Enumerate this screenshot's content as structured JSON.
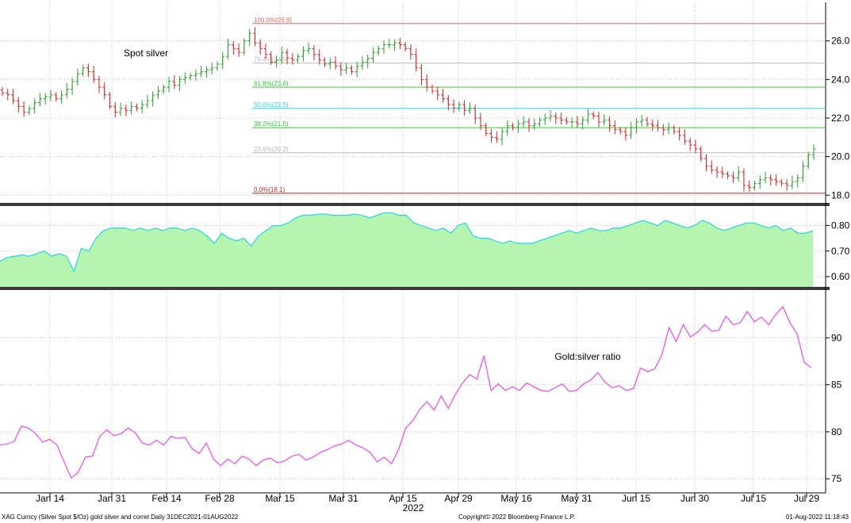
{
  "colors": {
    "bg": "#ffffff",
    "grid": "#c8c8c8",
    "candle_up": "#2ca02c",
    "candle_down": "#d62728",
    "correl_fill": "#b6f5b0",
    "correl_line": "#35d6e8",
    "ratio_line": "#ee55ee",
    "fib_0": "#cc2222",
    "fib_23_6": "#bbbbbb",
    "fib_38_2": "#33cc33",
    "fib_50": "#22dddd",
    "fib_61_8": "#33cc33",
    "fib_76_4": "#bbbbbb",
    "fib_100": "#ee6666"
  },
  "footer": {
    "left": "XAG Curncy (Silver Spot  $/Oz) gold silver and correl  Daily 31DEC2021-01AUG2022",
    "center": "Copyright© 2022 Bloomberg Finance L.P.",
    "right": "01-Aug-2022 11:18:43"
  },
  "chart_data": [
    {
      "type": "candlestick",
      "title": "Spot silver",
      "ylim": [
        17.6,
        28.0
      ],
      "yticks": [
        "18.0",
        "20.0",
        "22.0",
        "24.0",
        "26.0"
      ],
      "fib_levels": [
        {
          "label": "100.0%(26.9)",
          "value": 26.9,
          "color_key": "fib_100"
        },
        {
          "label": "76.4%(24.9)",
          "value": 24.85,
          "color_key": "fib_76_4"
        },
        {
          "label": "61.8%(23.6)",
          "value": 23.6,
          "color_key": "fib_61_8"
        },
        {
          "label": "50.0%(22.5)",
          "value": 22.5,
          "color_key": "fib_50"
        },
        {
          "label": "38.2%(21.5)",
          "value": 21.5,
          "color_key": "fib_38_2"
        },
        {
          "label": "23.6%(20.2)",
          "value": 20.2,
          "color_key": "fib_23_6"
        },
        {
          "label": "0.0%(18.1)",
          "value": 18.1,
          "color_key": "fib_0"
        }
      ],
      "close_path": [
        23.3,
        23.2,
        22.9,
        22.6,
        22.3,
        22.5,
        22.8,
        23.0,
        23.1,
        23.2,
        23.0,
        23.2,
        23.5,
        23.9,
        24.3,
        24.6,
        24.4,
        24.0,
        23.6,
        23.2,
        22.6,
        22.3,
        22.5,
        22.4,
        22.6,
        22.5,
        22.7,
        22.9,
        23.2,
        23.4,
        23.6,
        23.9,
        23.7,
        24.0,
        24.1,
        24.2,
        24.3,
        24.4,
        24.5,
        24.6,
        24.8,
        25.2,
        25.8,
        25.6,
        25.4,
        26.0,
        26.4,
        25.9,
        25.6,
        25.3,
        24.9,
        25.0,
        25.4,
        25.1,
        25.0,
        25.2,
        25.5,
        25.6,
        25.3,
        25.0,
        24.8,
        24.9,
        24.7,
        24.5,
        24.6,
        24.4,
        24.7,
        24.9,
        25.1,
        25.4,
        25.6,
        25.8,
        25.8,
        25.9,
        25.8,
        25.6,
        25.3,
        24.6,
        24.0,
        23.6,
        23.4,
        23.2,
        23.0,
        22.7,
        22.5,
        22.7,
        22.4,
        22.5,
        22.0,
        21.6,
        21.2,
        21.0,
        20.9,
        21.3,
        21.6,
        21.5,
        21.7,
        21.8,
        21.6,
        21.7,
        21.9,
        22.0,
        22.1,
        22.0,
        21.9,
        21.8,
        21.8,
        21.7,
        21.9,
        22.2,
        22.1,
        21.8,
        21.9,
        21.6,
        21.4,
        21.3,
        21.1,
        21.5,
        21.8,
        21.9,
        21.7,
        21.6,
        21.5,
        21.4,
        21.5,
        21.3,
        21.1,
        20.8,
        20.6,
        20.4,
        19.9,
        19.5,
        19.3,
        19.2,
        19.1,
        19.0,
        18.9,
        19.2,
        18.5,
        18.4,
        18.6,
        18.8,
        18.9,
        18.8,
        18.7,
        18.6,
        18.5,
        18.7,
        18.9,
        19.5,
        20.1,
        20.4
      ]
    },
    {
      "type": "area",
      "title": "",
      "ylim": [
        0.56,
        0.87
      ],
      "yticks": [
        "0.60",
        "0.70",
        "0.80"
      ],
      "values": [
        0.66,
        0.675,
        0.68,
        0.685,
        0.68,
        0.69,
        0.7,
        0.68,
        0.69,
        0.68,
        0.62,
        0.71,
        0.7,
        0.75,
        0.78,
        0.79,
        0.79,
        0.79,
        0.78,
        0.79,
        0.78,
        0.79,
        0.78,
        0.79,
        0.79,
        0.78,
        0.79,
        0.78,
        0.76,
        0.73,
        0.77,
        0.75,
        0.74,
        0.75,
        0.72,
        0.76,
        0.78,
        0.8,
        0.8,
        0.81,
        0.83,
        0.84,
        0.84,
        0.845,
        0.845,
        0.84,
        0.84,
        0.84,
        0.845,
        0.84,
        0.83,
        0.84,
        0.85,
        0.85,
        0.84,
        0.84,
        0.81,
        0.8,
        0.79,
        0.78,
        0.79,
        0.77,
        0.8,
        0.81,
        0.76,
        0.75,
        0.75,
        0.74,
        0.73,
        0.74,
        0.73,
        0.73,
        0.73,
        0.74,
        0.75,
        0.76,
        0.77,
        0.78,
        0.77,
        0.78,
        0.79,
        0.78,
        0.78,
        0.79,
        0.79,
        0.8,
        0.81,
        0.82,
        0.81,
        0.8,
        0.82,
        0.81,
        0.8,
        0.79,
        0.8,
        0.82,
        0.81,
        0.79,
        0.78,
        0.79,
        0.8,
        0.81,
        0.81,
        0.8,
        0.79,
        0.8,
        0.78,
        0.79,
        0.77,
        0.77,
        0.78
      ]
    },
    {
      "type": "line",
      "title": "Gold:silver ratio",
      "ylim": [
        73.5,
        95.0
      ],
      "yticks": [
        "75",
        "80",
        "85",
        "90"
      ],
      "values": [
        78.6,
        78.7,
        79.0,
        80.6,
        80.4,
        79.8,
        78.9,
        79.2,
        78.6,
        76.8,
        75.1,
        75.7,
        77.3,
        77.4,
        79.5,
        80.2,
        79.6,
        79.8,
        80.4,
        79.9,
        78.8,
        78.6,
        79.1,
        78.6,
        79.5,
        79.3,
        79.4,
        78.2,
        77.7,
        78.8,
        77.1,
        76.4,
        77.1,
        76.6,
        77.4,
        77.1,
        76.4,
        77.0,
        77.2,
        76.7,
        76.9,
        77.4,
        77.6,
        77.0,
        77.3,
        77.8,
        78.1,
        78.5,
        78.7,
        79.1,
        78.6,
        78.3,
        77.8,
        76.8,
        77.3,
        76.6,
        78.1,
        80.4,
        81.2,
        82.4,
        83.2,
        82.3,
        83.8,
        82.5,
        84.0,
        85.2,
        86.1,
        85.6,
        88.1,
        84.4,
        85.1,
        84.4,
        84.8,
        84.4,
        85.2,
        84.8,
        84.4,
        84.3,
        84.7,
        85.1,
        84.3,
        84.4,
        85.1,
        85.5,
        86.3,
        85.3,
        84.7,
        84.9,
        84.4,
        84.6,
        86.8,
        86.4,
        86.7,
        88.2,
        91.1,
        89.6,
        91.4,
        90.1,
        90.6,
        91.4,
        90.7,
        90.8,
        92.3,
        91.4,
        91.6,
        92.8,
        91.7,
        92.2,
        91.4,
        92.5,
        93.3,
        91.6,
        90.4,
        87.4,
        86.8
      ]
    }
  ],
  "x_axis": {
    "ticks": [
      "Jan 14",
      "Jan 31",
      "Feb 14",
      "Feb 28",
      "Mar 15",
      "Mar 31",
      "Apr 15",
      "Apr 29",
      "May 16",
      "May 31",
      "Jun 15",
      "Jun 30",
      "Jul 15",
      "Jul 29"
    ],
    "year_label": "2022"
  }
}
